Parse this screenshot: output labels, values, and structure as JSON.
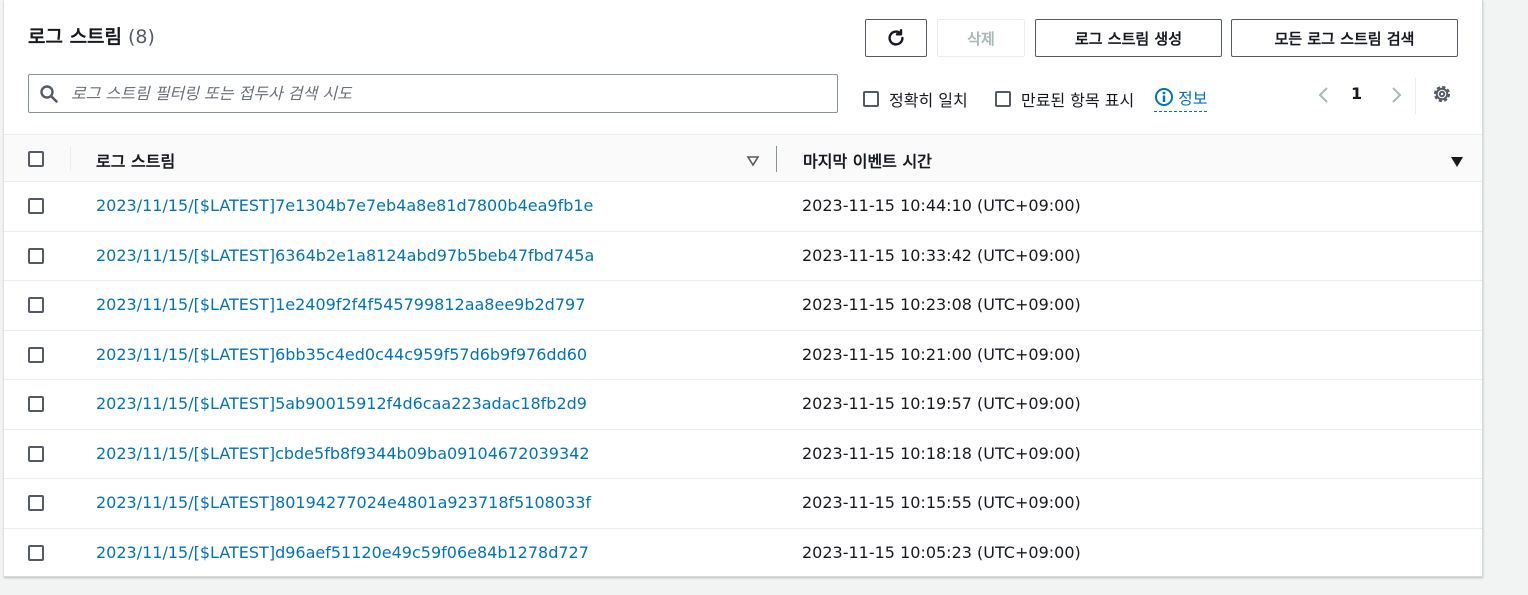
{
  "header": {
    "title": "로그 스트림",
    "count": "(8)"
  },
  "toolbar": {
    "delete_label": "삭제",
    "create_label": "로그 스트림 생성",
    "search_all_label": "모든 로그 스트림 검색"
  },
  "filter": {
    "placeholder": "로그 스트림 필터링 또는 접두사 검색 시도",
    "exact_match_label": "정확히 일치",
    "show_expired_label": "만료된 항목 표시",
    "info_label": "정보"
  },
  "pagination": {
    "current_page": "1"
  },
  "table": {
    "columns": [
      "로그 스트림",
      "마지막 이벤트 시간"
    ],
    "rows": [
      {
        "stream": "2023/11/15/[$LATEST]7e1304b7e7eb4a8e81d7800b4ea9fb1e",
        "time": "2023-11-15 10:44:10 (UTC+09:00)"
      },
      {
        "stream": "2023/11/15/[$LATEST]6364b2e1a8124abd97b5beb47fbd745a",
        "time": "2023-11-15 10:33:42 (UTC+09:00)"
      },
      {
        "stream": "2023/11/15/[$LATEST]1e2409f2f4f545799812aa8ee9b2d797",
        "time": "2023-11-15 10:23:08 (UTC+09:00)"
      },
      {
        "stream": "2023/11/15/[$LATEST]6bb35c4ed0c44c959f57d6b9f976dd60",
        "time": "2023-11-15 10:21:00 (UTC+09:00)"
      },
      {
        "stream": "2023/11/15/[$LATEST]5ab90015912f4d6caa223adac18fb2d9",
        "time": "2023-11-15 10:19:57 (UTC+09:00)"
      },
      {
        "stream": "2023/11/15/[$LATEST]cbde5fb8f9344b09ba09104672039342",
        "time": "2023-11-15 10:18:18 (UTC+09:00)"
      },
      {
        "stream": "2023/11/15/[$LATEST]80194277024e4801a923718f5108033f",
        "time": "2023-11-15 10:15:55 (UTC+09:00)"
      },
      {
        "stream": "2023/11/15/[$LATEST]d96aef51120e49c59f06e84b1278d727",
        "time": "2023-11-15 10:05:23 (UTC+09:00)"
      }
    ]
  },
  "icons": {
    "refresh": "refresh-icon",
    "search": "search-icon",
    "info": "info-icon",
    "prev": "chevron-left-icon",
    "next": "chevron-right-icon",
    "settings": "gear-icon",
    "sort": "caret-down-icon"
  },
  "colors": {
    "link": "#0073bb",
    "text": "#16191f",
    "disabled": "#aab7b8"
  }
}
